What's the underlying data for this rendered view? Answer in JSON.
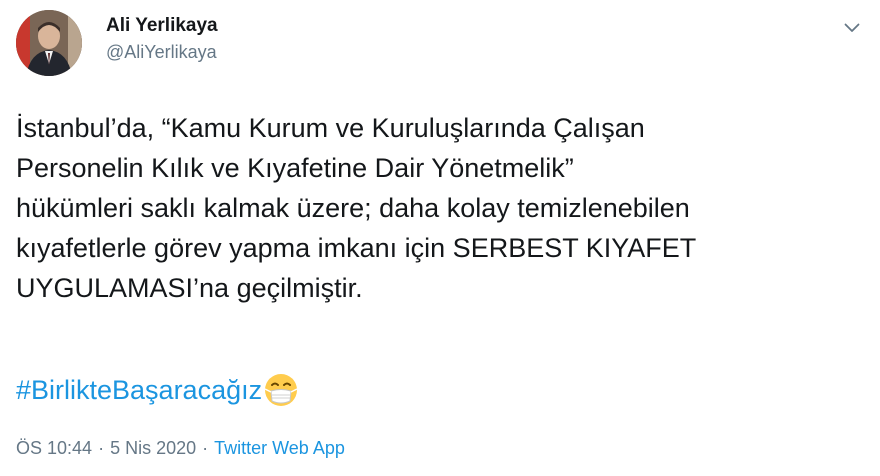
{
  "user": {
    "display_name": "Ali Yerlikaya",
    "handle": "@AliYerlikaya"
  },
  "tweet": {
    "text": "İstanbul’da, “Kamu Kurum ve Kuruluşlarında Çalışan\nPersonelin Kılık ve Kıyafetine Dair Yönetmelik”\nhükümleri saklı kalmak üzere; daha kolay temizlenebilen\nkıyafetlerle görev yapma imkanı için SERBEST KIYAFET\nUYGULAMASI’na geçilmiştir.",
    "hashtag": "#BirlikteBaşaracağız"
  },
  "meta": {
    "time": "ÖS 10:44",
    "separator": "·",
    "date": "5 Nis 2020",
    "source": "Twitter Web App"
  },
  "icons": {
    "caret": "chevron-down-icon",
    "emoji": "face-with-medical-mask-icon"
  },
  "colors": {
    "link": "#1b95e0",
    "secondary_text": "#657786",
    "primary_text": "#14171a"
  }
}
